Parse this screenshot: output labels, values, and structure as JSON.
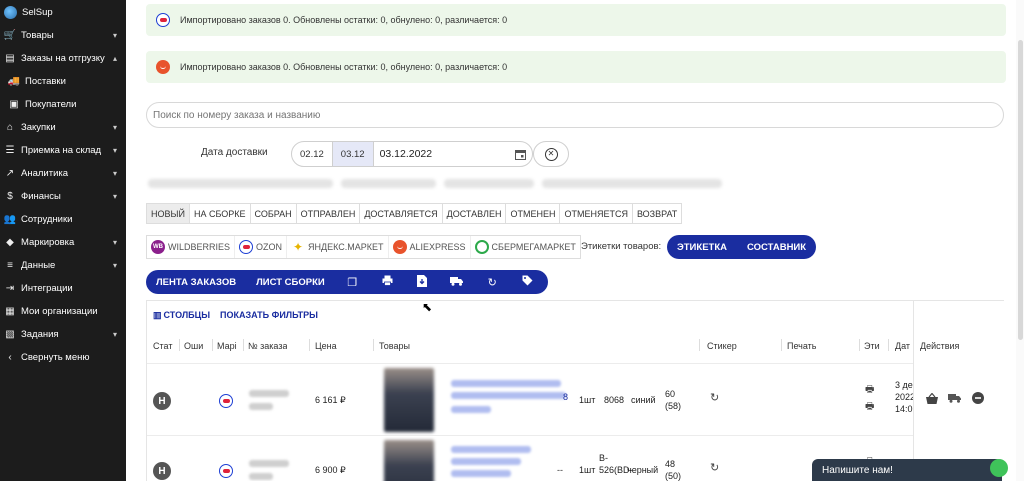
{
  "sidebar": {
    "brand": "SelSup",
    "items": [
      {
        "label": "Товары",
        "icon": "cart-icon",
        "chevron": "▾"
      },
      {
        "label": "Заказы на отгрузку",
        "icon": "document-icon",
        "chevron": "▴"
      },
      {
        "label": "Поставки",
        "icon": "truck-icon",
        "chevron": ""
      },
      {
        "label": "Покупатели",
        "icon": "contact-card-icon",
        "chevron": ""
      },
      {
        "label": "Закупки",
        "icon": "store-icon",
        "chevron": "▾"
      },
      {
        "label": "Приемка на склад",
        "icon": "list-icon",
        "chevron": "▾"
      },
      {
        "label": "Аналитика",
        "icon": "trend-icon",
        "chevron": "▾"
      },
      {
        "label": "Финансы",
        "icon": "dollar-icon",
        "chevron": "▾"
      },
      {
        "label": "Сотрудники",
        "icon": "people-icon",
        "chevron": ""
      },
      {
        "label": "Маркировка",
        "icon": "tag-icon",
        "chevron": "▾"
      },
      {
        "label": "Данные",
        "icon": "database-icon",
        "chevron": "▾"
      },
      {
        "label": "Интеграции",
        "icon": "plug-icon",
        "chevron": ""
      },
      {
        "label": "Мои организации",
        "icon": "building-icon",
        "chevron": ""
      },
      {
        "label": "Задания",
        "icon": "clipboard-icon",
        "chevron": "▾"
      },
      {
        "label": "Свернуть меню",
        "icon": "collapse-icon",
        "chevron": ""
      }
    ]
  },
  "notices": [
    {
      "marketplace": "ozon-icon",
      "text": "Импортировано заказов 0. Обновлены остатки: 0, обнулено: 0, различается: 0"
    },
    {
      "marketplace": "aliexpress-icon",
      "text": "Импортировано заказов 0. Обновлены остатки: 0, обнулено: 0, различается: 0"
    }
  ],
  "search": {
    "placeholder": "Поиск по номеру заказа и названию"
  },
  "delivery": {
    "label": "Дата доставки",
    "chips": [
      "02.12",
      "03.12"
    ],
    "value": "03.12.2022"
  },
  "status_tabs": [
    "НОВЫЙ",
    "НА СБОРКЕ",
    "СОБРАН",
    "ОТПРАВЛЕН",
    "ДОСТАВЛЯЕТСЯ",
    "ДОСТАВЛЕН",
    "ОТМЕНЕН",
    "ОТМЕНЯЕТСЯ",
    "ВОЗВРАТ"
  ],
  "marketplaces": [
    "WILDBERRIES",
    "OZON",
    "ЯНДЕКС.МАРКЕТ",
    "ALIEXPRESS",
    "СБЕРМЕГАМАРКЕТ"
  ],
  "labels": {
    "title": "Этикетки товаров:",
    "buttons": [
      "ЭТИКЕТКА",
      "СОСТАВНИК"
    ]
  },
  "toolbar": {
    "feed": "ЛЕНТА ЗАКАЗОВ",
    "pick_list": "ЛИСТ СБОРКИ"
  },
  "table": {
    "links": {
      "columns": "СТОЛБЦЫ",
      "filters": "ПОКАЗАТЬ ФИЛЬТРЫ"
    },
    "headers": [
      "Стат",
      "Оши",
      "Марі",
      "№ заказа",
      "Цена",
      "Товары",
      "Стикер",
      "Печать",
      "Эти",
      "Дат",
      "Действия"
    ],
    "rows": [
      {
        "status": "Н",
        "price": "6 161 ₽",
        "qty": "1шт",
        "article": "8068",
        "color": "синий",
        "stock": "60",
        "stock2": "(58)",
        "date1": "3 де",
        "date2": "2022",
        "date3": "14:0",
        "link_suffix": "8"
      },
      {
        "status": "Н",
        "price": "6 900 ₽",
        "qty": "1шт",
        "article": "B-",
        "article2": "526(BD-",
        "color": "черный",
        "stock": "48",
        "stock2": "(50)",
        "link_suffix": "--"
      }
    ]
  },
  "chat": {
    "label": "Напишите нам!"
  },
  "colors": {
    "primary": "#1a2da0",
    "notice_bg": "#edf7ea",
    "sidebar_bg": "#1c1c1c"
  }
}
